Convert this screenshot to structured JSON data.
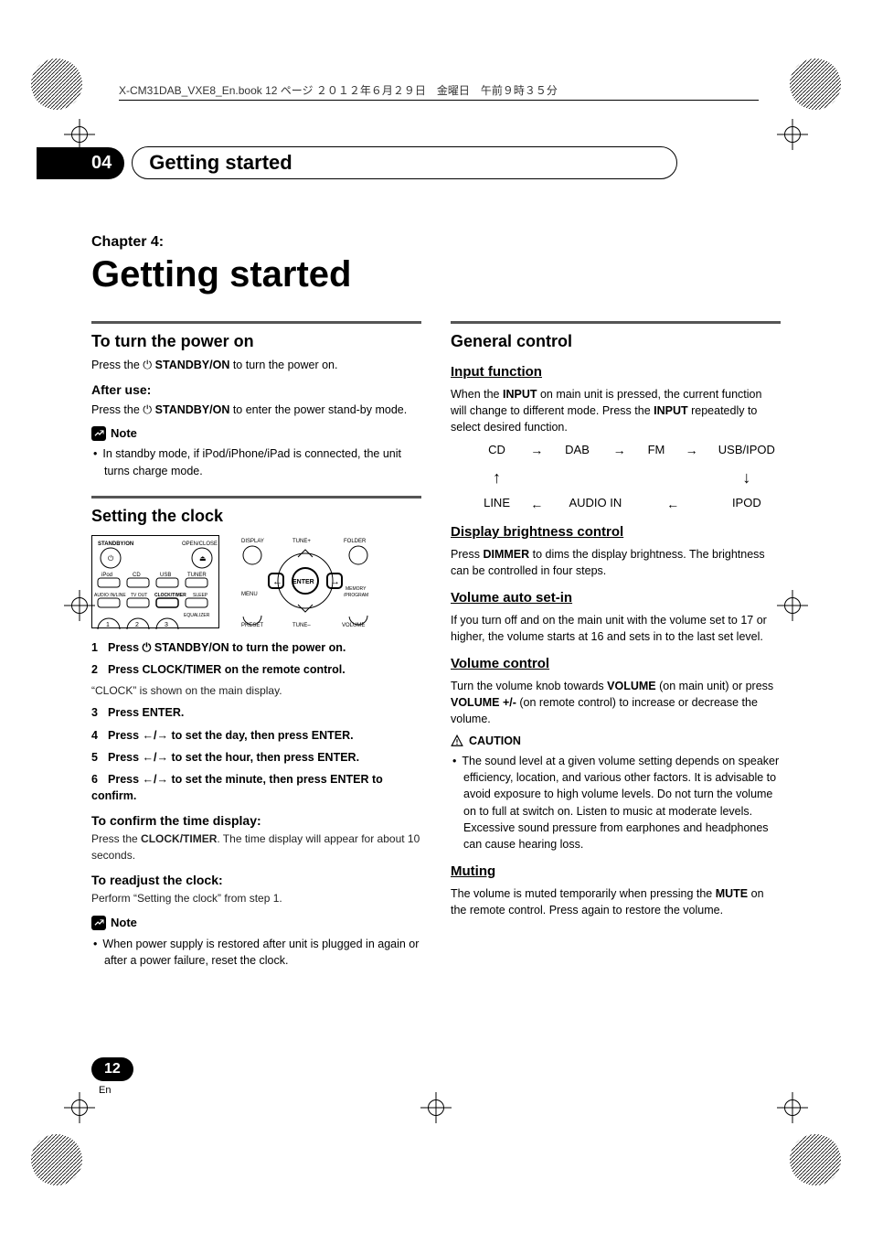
{
  "bookline": "X-CM31DAB_VXE8_En.book  12 ページ  ２０１２年６月２９日　金曜日　午前９時３５分",
  "header": {
    "chapter_num": "04",
    "chapter_tab": "Getting started"
  },
  "chapter": {
    "kicker": "Chapter 4:",
    "title": "Getting started"
  },
  "left": {
    "power": {
      "heading": "To turn the power on",
      "line1a": "Press the ",
      "line1b": " STANDBY/ON",
      "line1c": " to turn the power on.",
      "after_use": "After use:",
      "line2a": "Press the ",
      "line2b": " STANDBY/ON",
      "line2c": " to enter the power stand-by mode.",
      "note_label": "Note",
      "note1": "In standby mode, if iPod/iPhone/iPad is connected, the unit turns charge mode."
    },
    "clock": {
      "heading": "Setting the clock",
      "steps": [
        {
          "n": "1",
          "t": "Press ⏻ STANDBY/ON to turn the power on."
        },
        {
          "n": "2",
          "t": "Press CLOCK/TIMER on the remote control."
        },
        {
          "n": "3",
          "t": "Press ENTER."
        },
        {
          "n": "4",
          "t": "Press ←/→ to set the day, then press ENTER."
        },
        {
          "n": "5",
          "t": "Press ←/→ to set the hour, then press ENTER."
        },
        {
          "n": "6",
          "t": "Press ←/→ to set the minute, then press ENTER to confirm."
        }
      ],
      "step2_sub": "“CLOCK” is shown on the main display.",
      "confirm_h": "To confirm the time display:",
      "confirm_t": "Press the CLOCK/TIMER. The time display will appear for about 10 seconds.",
      "readjust_h": "To readjust the clock:",
      "readjust_t": "Perform “Setting the clock” from step 1.",
      "note_label": "Note",
      "note1": "When power supply is restored after unit is plugged in again or after a power failure, reset the clock."
    },
    "remote1": {
      "labels": [
        "STANDBY/ON",
        "OPEN/CLOSE",
        "iPod",
        "CD",
        "USB",
        "TUNER",
        "AUDIO IN/LINE",
        "TV OUT",
        "CLOCK/TIMER",
        "SLEEP",
        "EQUALIZER",
        "1",
        "2",
        "3"
      ]
    },
    "remote2": {
      "labels": [
        "DISPLAY",
        "TUNE+",
        "FOLDER",
        "MENU",
        "ENTER",
        "MEMORY /PROGRAM",
        "PRESET",
        "TUNE–",
        "VOLUME"
      ]
    }
  },
  "right": {
    "general": "General control",
    "input_h": "Input function",
    "input_t1": "When the ",
    "input_b1": "INPUT",
    "input_t2": " on main unit is pressed, the current function will change to different mode. Press the ",
    "input_b2": "INPUT",
    "input_t3": " repeatedly to select desired function.",
    "flow": {
      "cd": "CD",
      "dab": "DAB",
      "fm": "FM",
      "usb": "USB/IPOD",
      "line": "LINE",
      "audio": "AUDIO IN",
      "ipod": "IPOD"
    },
    "bright_h": "Display brightness control",
    "bright_t1": "Press ",
    "bright_b": "DIMMER",
    "bright_t2": " to dims the display brightness. The brightness can be controlled in four steps.",
    "vauto_h": "Volume auto set-in",
    "vauto_t": "If you turn off and on the main unit with the volume set to 17 or higher, the volume starts at 16 and sets in to the last set level.",
    "vol_h": "Volume control",
    "vol_t1": "Turn the volume knob towards ",
    "vol_b1": "VOLUME",
    "vol_t2": " (on main unit) or press ",
    "vol_b2": "VOLUME +/-",
    "vol_t3": " (on remote control) to increase or decrease the volume.",
    "caution_label": "CAUTION",
    "caution_t": "The sound level at a given volume setting depends on speaker efficiency, location, and various other factors. It is advisable to avoid exposure to high volume levels. Do not turn the volume on to full at switch on. Listen to music at moderate levels. Excessive sound pressure from earphones and headphones can cause hearing loss.",
    "mute_h": "Muting",
    "mute_t1": "The volume is muted temporarily when pressing the ",
    "mute_b": "MUTE",
    "mute_t2": " on the remote control. Press again to restore the volume."
  },
  "footer": {
    "page": "12",
    "lang": "En"
  }
}
